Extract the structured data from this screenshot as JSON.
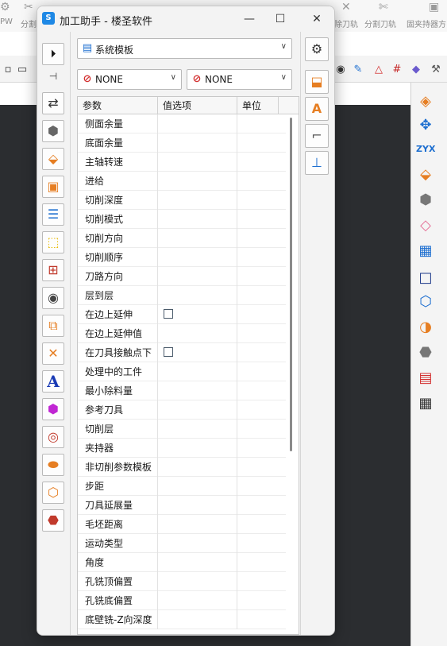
{
  "background": {
    "ribbon": [
      "PW",
      "分割",
      "除刀轨",
      "分割刀轨",
      "固夹持器方"
    ]
  },
  "window": {
    "title": "加工助手 - 楼圣软件",
    "logo": "S"
  },
  "template_select": {
    "value": "系统模板"
  },
  "filter_select_1": {
    "value": "NONE"
  },
  "filter_select_2": {
    "value": "NONE"
  },
  "grid": {
    "headers": {
      "name": "参数",
      "value": "值选项",
      "unit": "单位"
    },
    "rows": [
      {
        "name": "侧面余量"
      },
      {
        "name": "底面余量"
      },
      {
        "name": "主轴转速"
      },
      {
        "name": "进给"
      },
      {
        "name": "切削深度"
      },
      {
        "name": "切削模式"
      },
      {
        "name": "切削方向"
      },
      {
        "name": "切削顺序"
      },
      {
        "name": "刀路方向"
      },
      {
        "name": "层到层"
      },
      {
        "name": "在边上延伸",
        "checkbox": true
      },
      {
        "name": "在边上延伸值"
      },
      {
        "name": "在刀具接触点下",
        "checkbox": true
      },
      {
        "name": "处理中的工件"
      },
      {
        "name": "最小除料量"
      },
      {
        "name": "参考刀具"
      },
      {
        "name": "切削层"
      },
      {
        "name": "夹持器"
      },
      {
        "name": "非切削参数模板"
      },
      {
        "name": "步距"
      },
      {
        "name": "刀具延展量"
      },
      {
        "name": "毛坯距离"
      },
      {
        "name": "运动类型"
      },
      {
        "name": "角度"
      },
      {
        "name": "孔铣顶偏置"
      },
      {
        "name": "孔铣底偏置"
      },
      {
        "name": "底壁铣-Z向深度"
      }
    ]
  },
  "colors": {
    "accent": "#1e88e5",
    "none_icon": "#d32f2f",
    "canvas": "#2b2d30"
  }
}
